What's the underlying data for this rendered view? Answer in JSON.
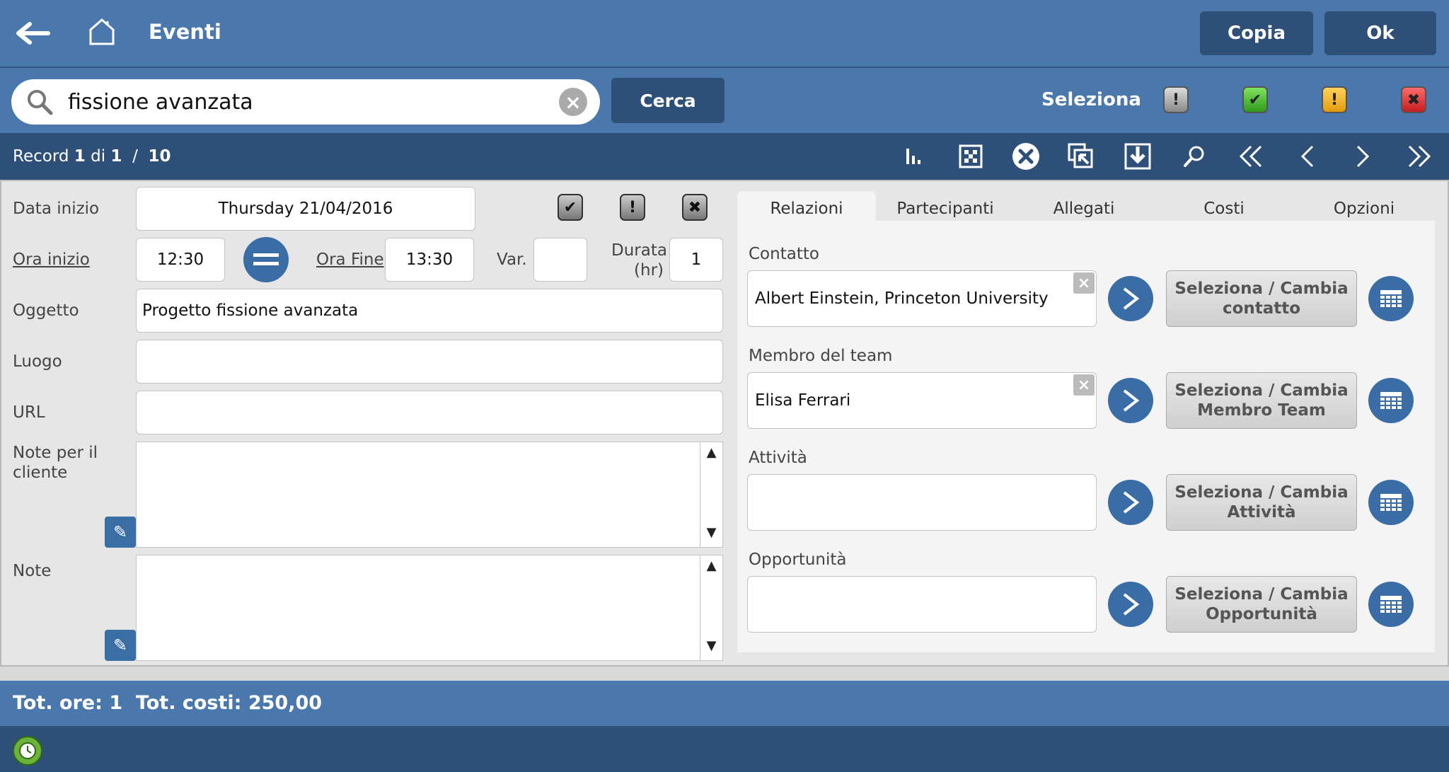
{
  "header": {
    "title": "Eventi",
    "copy_label": "Copia",
    "ok_label": "Ok"
  },
  "search": {
    "value": "fissione avanzata",
    "button": "Cerca",
    "select_label": "Seleziona"
  },
  "record": {
    "prefix": "Record",
    "current": "1",
    "of_label": "di",
    "total": "1",
    "sep": "/",
    "page_size": "10"
  },
  "form": {
    "data_inizio_label": "Data inizio",
    "data_inizio_value": "Thursday 21/04/2016",
    "ora_inizio_label": "Ora inizio",
    "ora_inizio_value": "12:30",
    "ora_fine_label": "Ora Fine",
    "ora_fine_value": "13:30",
    "var_label": "Var.",
    "var_value": "",
    "durata_label_1": "Durata",
    "durata_label_2": "(hr)",
    "durata_value": "1",
    "oggetto_label": "Oggetto",
    "oggetto_value": "Progetto fissione avanzata",
    "luogo_label": "Luogo",
    "luogo_value": "",
    "url_label": "URL",
    "url_value": "",
    "note_cliente_label_1": "Note per il",
    "note_cliente_label_2": "cliente",
    "note_label": "Note"
  },
  "tabs": [
    "Relazioni",
    "Partecipanti",
    "Allegati",
    "Costi",
    "Opzioni"
  ],
  "relations": {
    "contatto": {
      "label": "Contatto",
      "value": "Albert Einstein, Princeton University",
      "btn_1": "Seleziona / Cambia",
      "btn_2": "contatto"
    },
    "membro": {
      "label": "Membro del team",
      "value": "Elisa Ferrari",
      "btn_1": "Seleziona / Cambia",
      "btn_2": "Membro Team"
    },
    "attivita": {
      "label": "Attività",
      "value": "",
      "btn_1": "Seleziona / Cambia",
      "btn_2": "Attività"
    },
    "opportunita": {
      "label": "Opportunità",
      "value": "",
      "btn_1": "Seleziona / Cambia",
      "btn_2": "Opportunità"
    }
  },
  "totals": {
    "text": "Tot. ore: 1  Tot. costi: 250,00"
  },
  "colors": {
    "header": "#4a78ac",
    "dark": "#2e5078",
    "status_green": "#3fbf2a",
    "status_yellow": "#f3b21b",
    "status_red": "#e83232"
  }
}
